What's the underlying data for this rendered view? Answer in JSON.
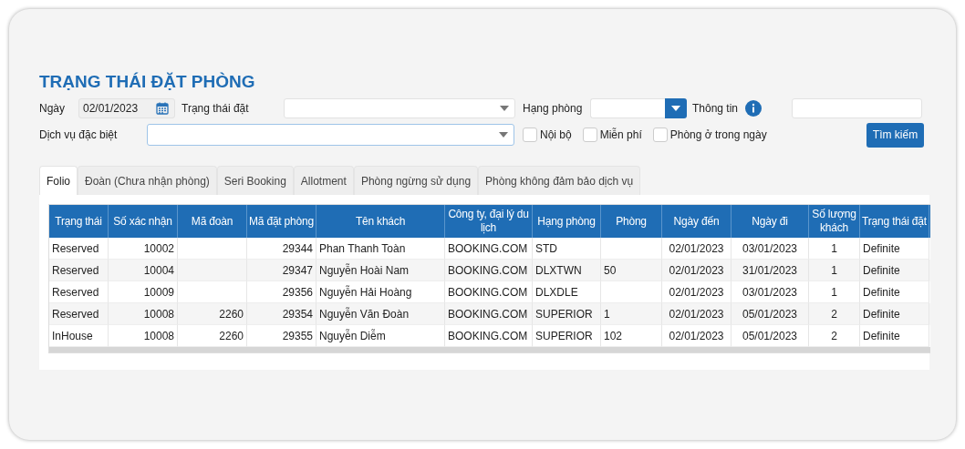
{
  "title": "TRẠNG THÁI ĐẶT PHÒNG",
  "filters": {
    "date_label": "Ngày",
    "date_value": "02/01/2023",
    "status_label": "Trạng thái đặt",
    "room_type_label": "Hạng phòng",
    "info_label": "Thông tin",
    "service_label": "Dịch vụ đặc biệt",
    "checkboxes": [
      {
        "label": "Nội bộ",
        "checked": false
      },
      {
        "label": "Miễn phí",
        "checked": false
      },
      {
        "label": "Phòng ở trong ngày",
        "checked": false
      }
    ],
    "search_button": "Tìm kiếm"
  },
  "tabs": [
    {
      "label": "Folio",
      "selected": true
    },
    {
      "label": "Đoàn (Chưa nhận phòng)",
      "selected": false
    },
    {
      "label": "Seri Booking",
      "selected": false
    },
    {
      "label": "Allotment",
      "selected": false
    },
    {
      "label": "Phòng ngừng sử dụng",
      "selected": false
    },
    {
      "label": "Phòng không đảm bảo dịch vụ",
      "selected": false
    }
  ],
  "table": {
    "columns": [
      "Trạng thái",
      "Số xác nhận",
      "Mã đoàn",
      "Mã đặt phòng",
      "Tên khách",
      "Công ty, đại lý du lịch",
      "Hạng phòng",
      "Phòng",
      "Ngày đến",
      "Ngày đi",
      "Số lượng khách",
      "Trạng thái đặt"
    ],
    "rows": [
      [
        "Reserved",
        "10002",
        "",
        "29344",
        "Phan Thanh Toàn",
        "BOOKING.COM",
        "STD",
        "",
        "02/01/2023",
        "03/01/2023",
        "1",
        "Definite"
      ],
      [
        "Reserved",
        "10004",
        "",
        "29347",
        "Nguyễn Hoài Nam",
        "BOOKING.COM",
        "DLXTWN",
        "50",
        "02/01/2023",
        "31/01/2023",
        "1",
        "Definite"
      ],
      [
        "Reserved",
        "10009",
        "",
        "29356",
        "Nguyễn Hải Hoàng",
        "BOOKING.COM",
        "DLXDLE",
        "",
        "02/01/2023",
        "03/01/2023",
        "1",
        "Definite"
      ],
      [
        "Reserved",
        "10008",
        "2260",
        "29354",
        "Nguyễn Văn Đoàn",
        "BOOKING.COM",
        "SUPERIOR",
        "1",
        "02/01/2023",
        "05/01/2023",
        "2",
        "Definite"
      ],
      [
        "InHouse",
        "10008",
        "2260",
        "29355",
        "Nguyễn Diễm",
        "BOOKING.COM",
        "SUPERIOR",
        "102",
        "02/01/2023",
        "05/01/2023",
        "2",
        "Definite"
      ]
    ]
  }
}
